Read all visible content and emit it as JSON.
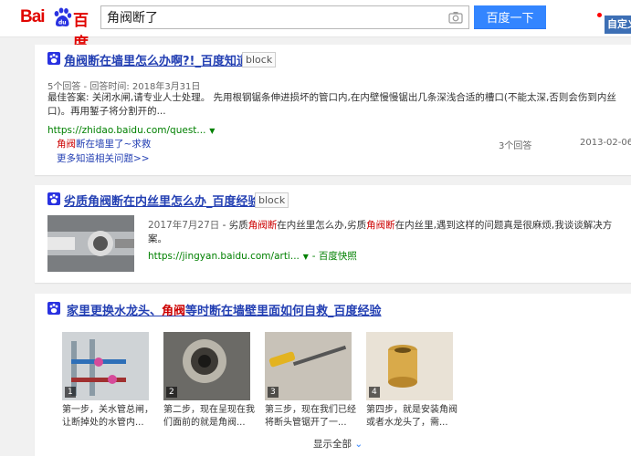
{
  "header": {
    "logo_bai": "Bai",
    "logo_cn": "百度",
    "search_value": "角阀断了",
    "search_button": "百度一下",
    "custom_button": "自定义"
  },
  "result1": {
    "title": "角阀断在墙里怎么办啊?!_百度知道",
    "block": "block",
    "meta": "5个回答 - 回答时间: 2018年3月31日",
    "answer": "最佳答案: 关闭水闸,请专业人士处理。 先用根钢锯条伸进损坏的管口内,在内壁慢慢锯出几条深浅合适的槽口(不能太深,否则会伤到内丝口)。再用錾子将分割开的...",
    "url": "https://zhidao.baidu.com/quest...",
    "related_hl": "角阀",
    "related_rest": "断在墙里了~求救",
    "related_count": "3个回答",
    "related_date": "2013-02-06",
    "more": "更多知道相关问题>>"
  },
  "result2": {
    "title_pre": "劣质角阀断在内丝里怎么办_百度经验",
    "block": "block",
    "date": "2017年7月27日",
    "sep": " - ",
    "s1": "劣质",
    "h1": "角阀断",
    "s2": "在内丝里怎么办,劣质",
    "h2": "角阀断",
    "s3": "在内丝里,遇到这样的问题真是很麻烦,我谈谈解决方案。",
    "url": "https://jingyan.baidu.com/arti...",
    "snapshot": "百度快照"
  },
  "result3": {
    "title_a": "家里更换水龙头、",
    "title_hl": "角阀",
    "title_b": "等时断在墙壁里面如何自救_百度经验",
    "steps": [
      {
        "num": "1",
        "caption": "第一步，关水管总闸，让断掉处的水管内..."
      },
      {
        "num": "2",
        "caption": "第二步，现在呈现在我们面前的就是角阀..."
      },
      {
        "num": "3",
        "caption": "第三步，现在我们已经将断头管锯开了一..."
      },
      {
        "num": "4",
        "caption": "第四步，就是安装角阀或者水龙头了，需..."
      }
    ],
    "show_all": "显示全部"
  },
  "colors": {
    "link_blue": "#2440b3",
    "highlight_red": "#cc0000",
    "url_green": "#008000",
    "button_blue": "#3385ff",
    "logo_red": "#e10602"
  }
}
